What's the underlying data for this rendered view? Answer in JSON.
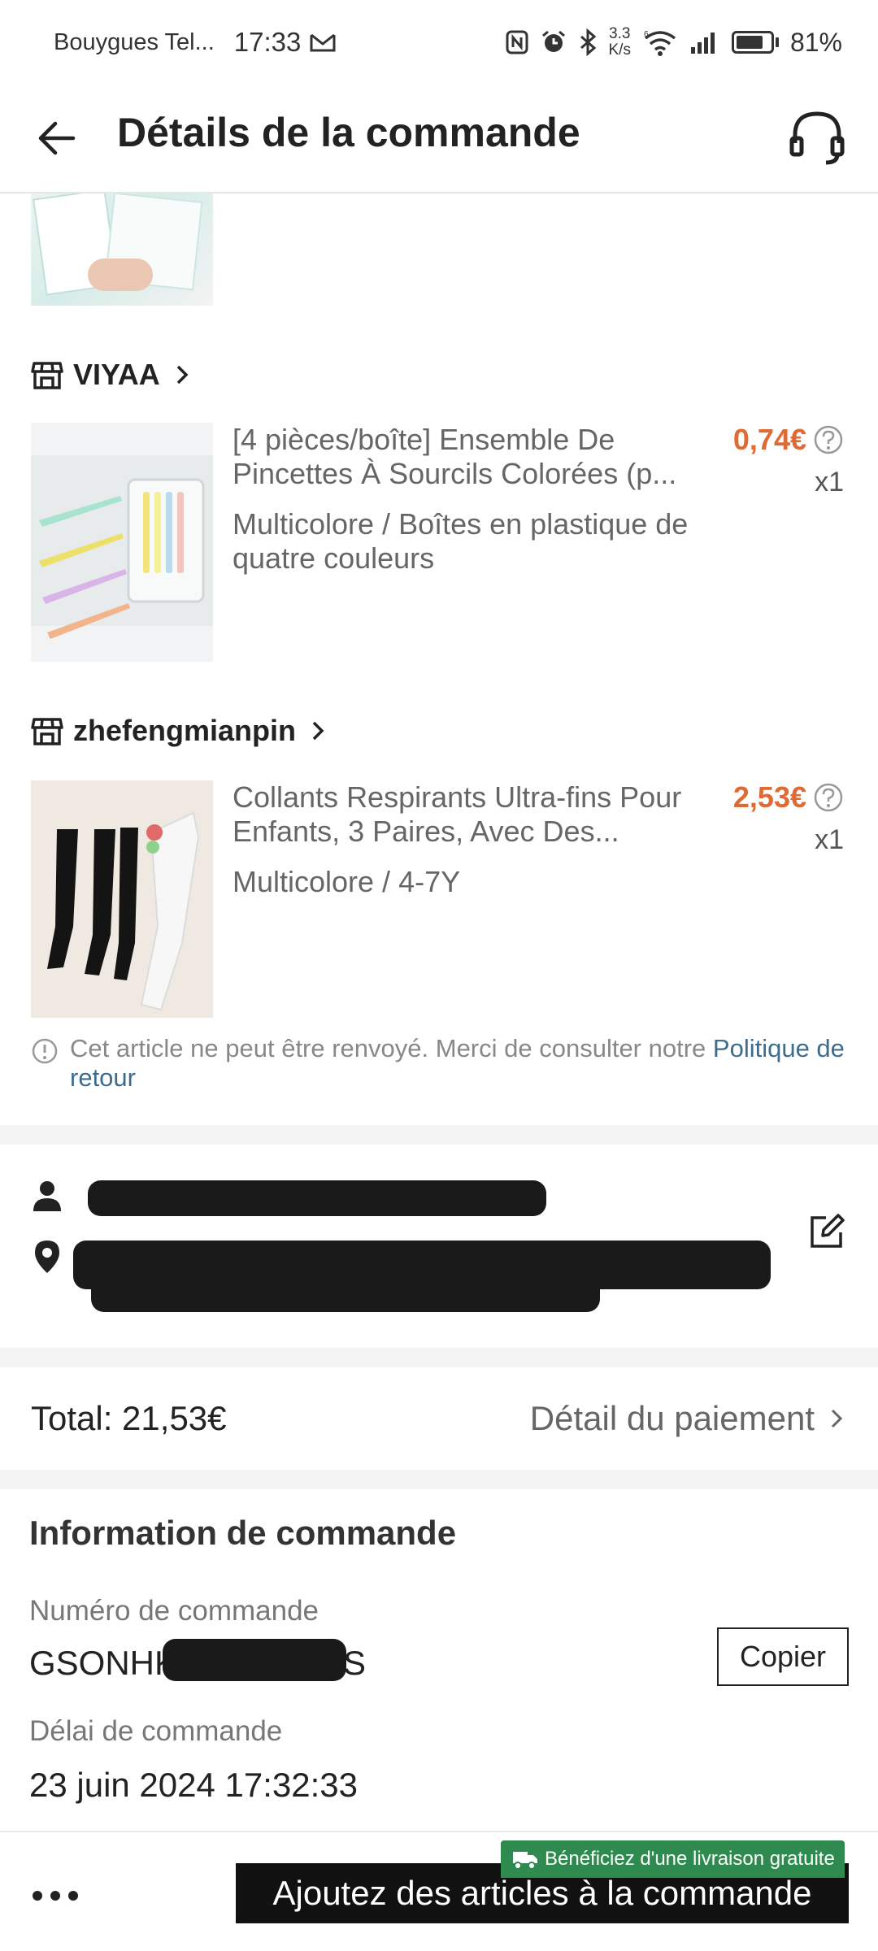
{
  "status_bar": {
    "carrier": "Bouygues Tel...",
    "time": "17:33",
    "net_speed_value": "3.3",
    "net_speed_unit": "K/s",
    "battery_percent": "81%",
    "battery_level": 0.81
  },
  "header": {
    "title": "Détails de la commande"
  },
  "shops": [
    {
      "name": "VIYAA",
      "item": {
        "title": "[4 pièces/boîte] Ensemble De Pincettes À Sourcils Colorées (p...",
        "variant": "Multicolore / Boîtes en plastique de quatre couleurs",
        "price": "0,74€",
        "quantity": "x1"
      }
    },
    {
      "name": "zhefengmianpin",
      "item": {
        "title": "Collants Respirants Ultra-fins Pour Enfants, 3 Paires, Avec Des...",
        "variant": "Multicolore / 4-7Y",
        "price": "2,53€",
        "quantity": "x1"
      }
    }
  ],
  "return_notice": {
    "text": "Cet article ne peut être renvoyé. Merci de consulter notre ",
    "link": "Politique de retour"
  },
  "summary": {
    "total": "Total: 21,53€",
    "payment_detail": "Détail du paiement"
  },
  "order_info": {
    "title": "Information de commande",
    "number_label": "Numéro de commande",
    "number_prefix": "GSONHK",
    "number_suffix": "S",
    "copy_button": "Copier",
    "date_label": "Délai de commande",
    "date_value": "23 juin 2024 17:32:33"
  },
  "bottom_bar": {
    "promo": "Bénéficiez d'une livraison gratuite",
    "cta": "Ajoutez des articles à la commande"
  },
  "colors": {
    "price": "#e06a33",
    "link": "#3d6c8e",
    "promo_bg": "#2f8a4f",
    "cta_bg": "#111111"
  }
}
